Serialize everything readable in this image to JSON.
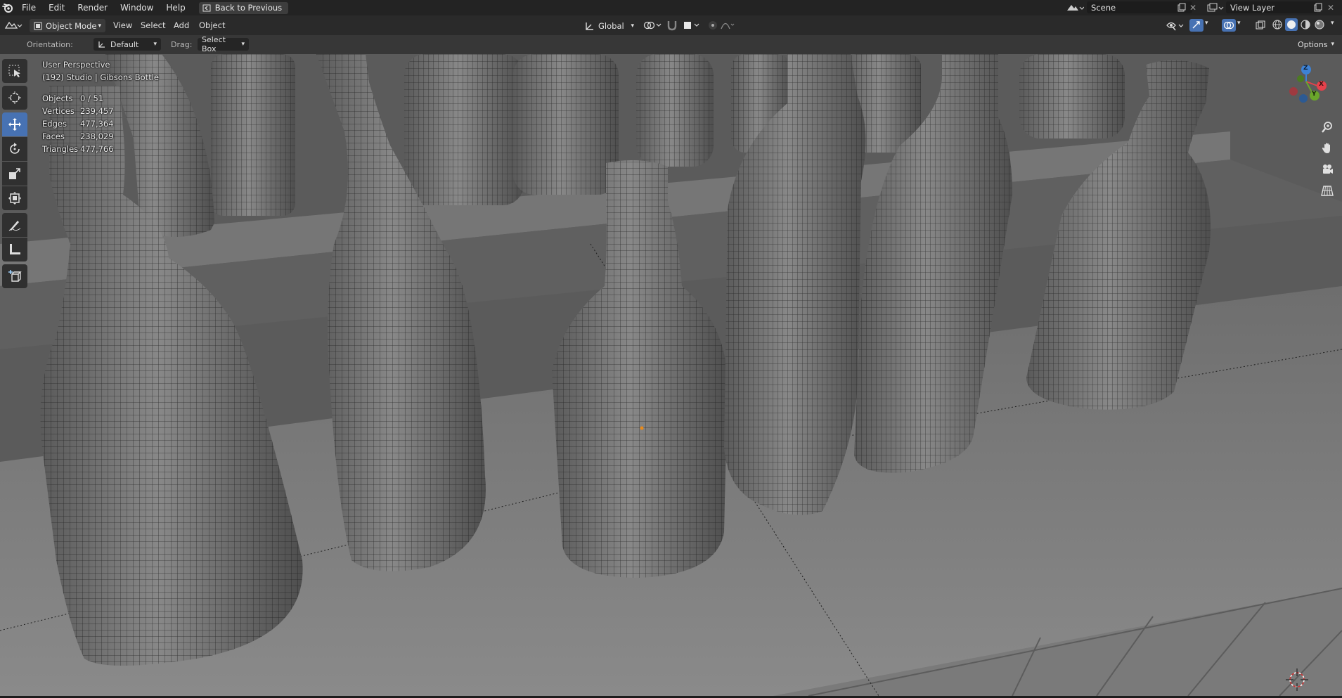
{
  "menu": {
    "items": [
      "File",
      "Edit",
      "Render",
      "Window",
      "Help"
    ],
    "back_button": "Back to Previous"
  },
  "scene": {
    "name": "Scene",
    "view_layer": "View Layer"
  },
  "header": {
    "mode": "Object Mode",
    "menus": [
      "View",
      "Select",
      "Add",
      "Object"
    ],
    "transform_orientation": "Global"
  },
  "tool_settings": {
    "orientation_label": "Orientation:",
    "orientation_value": "Default",
    "drag_label": "Drag:",
    "drag_value": "Select Box",
    "options": "Options"
  },
  "viewport": {
    "view_name": "User Perspective",
    "collection": "(192) Studio | Gibsons Bottle",
    "stats": [
      {
        "label": "Objects",
        "value": "0 / 51"
      },
      {
        "label": "Vertices",
        "value": "239,457"
      },
      {
        "label": "Edges",
        "value": "477,364"
      },
      {
        "label": "Faces",
        "value": "238,029"
      },
      {
        "label": "Triangles",
        "value": "477,766"
      }
    ]
  },
  "gizmo": {
    "z": "Z",
    "y": "Y",
    "x": "X"
  },
  "colors": {
    "accent": "#4772b3",
    "header": "#2a2a2a",
    "topbar": "#232323",
    "gizmo_x": "#e5414b",
    "gizmo_y": "#6aa62b",
    "gizmo_z": "#3d82d5"
  }
}
